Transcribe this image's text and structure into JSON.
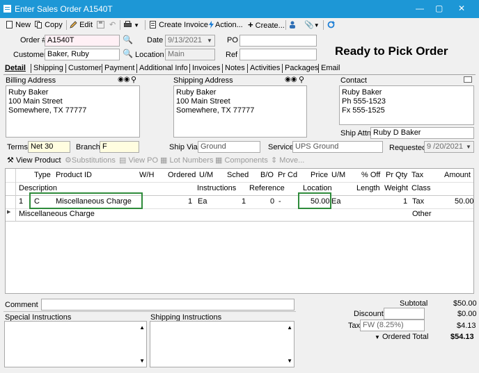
{
  "window": {
    "title": "Enter Sales Order A1540T"
  },
  "toolbar": {
    "new": "New",
    "copy": "Copy",
    "edit": "Edit",
    "create_invoice": "Create Invoice",
    "action": "Action...",
    "create": "Create..."
  },
  "header": {
    "order_label": "Order #",
    "order_value": "A1540T",
    "date_label": "Date",
    "date_value": "9/13/2021",
    "po_label": "PO",
    "po_value": "",
    "customer_label": "Customer",
    "customer_value": "Baker, Ruby",
    "location_label": "Location",
    "location_value": "Main",
    "ref_label": "Ref",
    "ref_value": "",
    "status": "Ready to Pick Order"
  },
  "tabs": [
    "Detail",
    "Shipping",
    "Customer",
    "Payment",
    "Additional Info",
    "Invoices",
    "Notes",
    "Activities",
    "Packages",
    "Email"
  ],
  "billing": {
    "label": "Billing Address",
    "lines": [
      "Ruby Baker",
      "100 Main Street",
      "Somewhere, TX 77777"
    ]
  },
  "shipping": {
    "label": "Shipping Address",
    "lines": [
      "Ruby Baker",
      "100 Main Street",
      "Somewhere, TX 77777"
    ]
  },
  "contact": {
    "label": "Contact",
    "lines": [
      "Ruby Baker",
      "Ph 555-1523",
      "Fx 555-1525"
    ],
    "ship_attn_label": "Ship Attn",
    "ship_attn_value": "Ruby D Baker"
  },
  "terms": {
    "terms_label": "Terms",
    "terms_value": "Net 30",
    "branch_label": "Branch",
    "branch_value": "F",
    "shipvia_label": "Ship Via",
    "shipvia_value": "Ground",
    "service_label": "Service",
    "service_value": "UPS Ground",
    "requested_label": "Requested",
    "requested_value": "9 /20/2021"
  },
  "lines_toolbar": {
    "view_product": "View Product",
    "substitutions": "Substitutions",
    "view_po": "View PO",
    "lot_numbers": "Lot Numbers",
    "components": "Components",
    "move": "Move..."
  },
  "grid": {
    "headers1": [
      "Type",
      "Product ID",
      "W/H",
      "Ordered",
      "U/M",
      "Sched",
      "B/O",
      "Pr Cd",
      "Price",
      "U/M",
      "% Off",
      "Pr Qty",
      "Tax",
      "Amount"
    ],
    "headers2": [
      "Description",
      "Instructions",
      "Reference",
      "Location",
      "Length",
      "Weight",
      "Class"
    ],
    "row": {
      "num": "1",
      "type": "C",
      "product": "Miscellaneous Charge",
      "ordered": "1",
      "um": "Ea",
      "sched": "1",
      "bo": "0",
      "prcd": "-",
      "price": "50.00",
      "um2": "Ea",
      "prqty": "1",
      "tax": "Tax",
      "amount": "50.00",
      "description": "Miscellaneous Charge",
      "class": "Other"
    }
  },
  "footer": {
    "comment_label": "Comment",
    "comment_value": "",
    "special_label": "Special Instructions",
    "shipping_instr_label": "Shipping Instructions",
    "subtotal_label": "Subtotal",
    "subtotal_value": "$50.00",
    "discount_label": "Discount",
    "discount_value": "$0.00",
    "tax_label": "Tax",
    "tax_field": "FW (8.25%)",
    "tax_value": "$4.13",
    "ordered_total_label": "Ordered Total",
    "ordered_total_value": "$54.13"
  },
  "colors": {
    "titlebar": "#1d97d6",
    "highlight": "#2e8b3a",
    "required_field": "#fffde0"
  }
}
